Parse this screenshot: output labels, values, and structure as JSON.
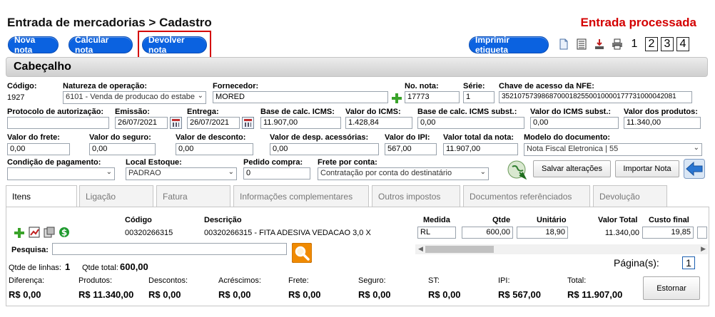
{
  "header": {
    "title": "Entrada de mercadorias > Cadastro",
    "status": "Entrada processada"
  },
  "toolbar": {
    "new_label": "Nova nota",
    "calc_label": "Calcular nota",
    "return_label": "Devolver nota",
    "print_label": "Imprimir etiqueta",
    "pages": [
      "1",
      "2",
      "3",
      "4"
    ]
  },
  "section": {
    "title": "Cabeçalho"
  },
  "form": {
    "codigo": {
      "label": "Código:",
      "value": "1927"
    },
    "natureza": {
      "label": "Natureza de operação:",
      "value": "6101 - Venda de producao do estabe"
    },
    "fornecedor": {
      "label": "Fornecedor:",
      "value": "MORED"
    },
    "numero": {
      "label": "No. nota:",
      "value": "17773"
    },
    "serie": {
      "label": "Série:",
      "value": "1"
    },
    "chave": {
      "label": "Chave de acesso da NFE:",
      "value": "35210757398687000182550010000177731000042081"
    },
    "protocolo": {
      "label": "Protocolo de autorização:",
      "value": ""
    },
    "emissao": {
      "label": "Emissão:",
      "value": "26/07/2021"
    },
    "entrega": {
      "label": "Entrega:",
      "value": "26/07/2021"
    },
    "base_icms": {
      "label": "Base de calc. ICMS:",
      "value": "11.907,00"
    },
    "valor_icms": {
      "label": "Valor do ICMS:",
      "value": "1.428,84"
    },
    "base_icms_st": {
      "label": "Base de calc. ICMS subst.:",
      "value": "0,00"
    },
    "valor_icms_st": {
      "label": "Valor do ICMS subst.:",
      "value": "0,00"
    },
    "valor_produtos": {
      "label": "Valor dos produtos:",
      "value": "11.340,00"
    },
    "frete": {
      "label": "Valor do frete:",
      "value": "0,00"
    },
    "seguro": {
      "label": "Valor do seguro:",
      "value": "0,00"
    },
    "desconto": {
      "label": "Valor de desconto:",
      "value": "0,00"
    },
    "despesas": {
      "label": "Valor de desp. acessórias:",
      "value": "0,00"
    },
    "ipi": {
      "label": "Valor do IPI:",
      "value": "567,00"
    },
    "total": {
      "label": "Valor total da nota:",
      "value": "11.907,00"
    },
    "modelo": {
      "label": "Modelo do documento:",
      "value": "Nota Fiscal Eletronica | 55"
    },
    "condicao": {
      "label": "Condição de pagamento:",
      "value": ""
    },
    "local": {
      "label": "Local Estoque:",
      "value": "PADRAO"
    },
    "pedido": {
      "label": "Pedido compra:",
      "value": "0"
    },
    "frete_conta": {
      "label": "Frete por conta:",
      "value": "Contratação por conta do destinatário"
    },
    "save_label": "Salvar alterações",
    "import_label": "Importar Nota"
  },
  "tabs": [
    {
      "label": "Itens"
    },
    {
      "label": "Ligação"
    },
    {
      "label": "Fatura"
    },
    {
      "label": "Informações complementares"
    },
    {
      "label": "Outros impostos"
    },
    {
      "label": "Documentos referênciados"
    },
    {
      "label": "Devolução"
    }
  ],
  "items": {
    "columns": {
      "codigo": "Código",
      "descricao": "Descrição",
      "medida": "Medida",
      "qtde": "Qtde",
      "unitario": "Unitário",
      "valor_total": "Valor Total",
      "custo_final": "Custo final"
    },
    "rows": [
      {
        "codigo": "00320266315",
        "descricao": "00320266315 - FITA ADESIVA VEDACAO 3,0 X",
        "medida": "RL",
        "qtde": "600,00",
        "unitario": "18,90",
        "valor_total": "11.340,00",
        "custo_final": "19,85"
      }
    ],
    "search_label": "Pesquisa:",
    "search_value": "",
    "pagination_label": "Página(s):",
    "current_page": "1",
    "line_count_label": "Qtde de linhas:",
    "line_count": "1",
    "qty_total_label": "Qtde total:",
    "qty_total": "600,00"
  },
  "totals": [
    {
      "label": "Diferença:",
      "value": "R$ 0,00"
    },
    {
      "label": "Produtos:",
      "value": "R$ 11.340,00"
    },
    {
      "label": "Descontos:",
      "value": "R$ 0,00"
    },
    {
      "label": "Acréscimos:",
      "value": "R$ 0,00"
    },
    {
      "label": "Frete:",
      "value": "R$ 0,00"
    },
    {
      "label": "Seguro:",
      "value": "R$ 0,00"
    },
    {
      "label": "ST:",
      "value": "R$ 0,00"
    },
    {
      "label": "IPI:",
      "value": "R$ 567,00"
    },
    {
      "label": "Total:",
      "value": "R$ 11.907,00"
    }
  ],
  "reverse_label": "Estornar",
  "colors": {
    "accent": "#0b62e0",
    "status": "#d40000",
    "add": "#3aa32a",
    "search": "#f08a00"
  }
}
